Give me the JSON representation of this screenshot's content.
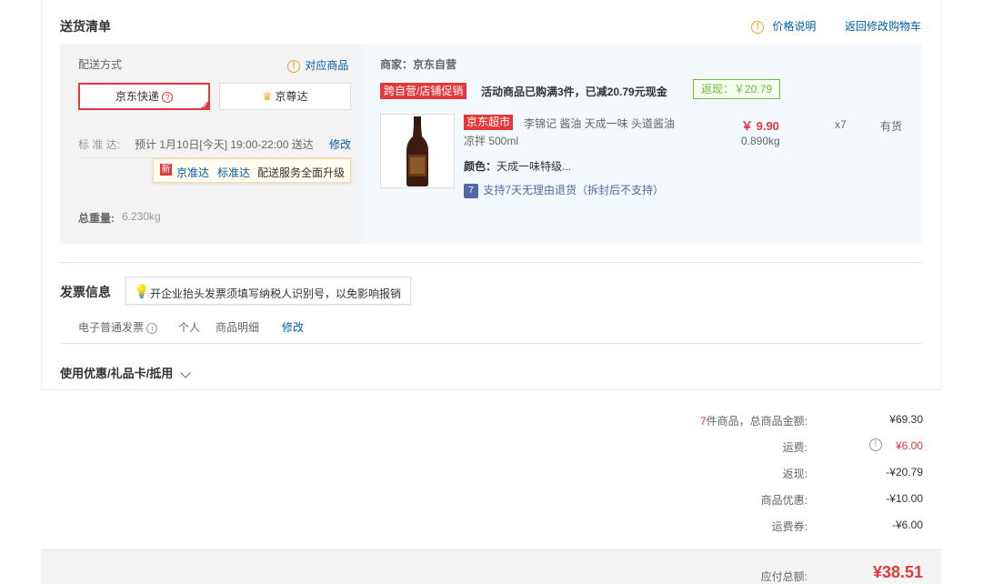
{
  "header": {
    "title": "送货清单",
    "price_note": "价格说明",
    "back_cart": "返回修改购物车"
  },
  "shipping": {
    "method_label": "配送方式",
    "related_goods": "对应商品",
    "option_selected": "京东快递",
    "option_other": "京尊达",
    "schedule_label": "标 准 达:",
    "schedule_value": "预计 1月10日[今天] 19:00-22:00 送达",
    "modify": "修改",
    "tip_badge": "新",
    "tip_link1": "京准达",
    "tip_link2": "标准达",
    "tip_text": "配送服务全面升级",
    "weight_label": "总重量:",
    "weight_value": "6.230kg"
  },
  "merchant": {
    "label": "商家：京东自营",
    "promo_tag": "跨自营/店铺促销",
    "promo_text": "活动商品已购满3件，已减20.79元现金",
    "rebate": "返现：￥20.79"
  },
  "product": {
    "store_tag": "京东超市",
    "name": "李锦记 酱油 天成一味 头道酱油 凉拌 500ml",
    "price": "￥ 9.90",
    "weight": "0.890kg",
    "qty": "x7",
    "stock": "有货",
    "color_label": "颜色：",
    "color_value": "天成一味特级...",
    "return_badge": "7",
    "return_text": "支持7天无理由退货（拆封后不支持）"
  },
  "invoice": {
    "title": "发票信息",
    "tip": "开企业抬头发票须填写纳税人识别号，以免影响报销",
    "type": "电子普通发票",
    "personal": "个人",
    "detail": "商品明细",
    "modify": "修改"
  },
  "discount": {
    "title": "使用优惠/礼品卡/抵用"
  },
  "summary": {
    "count": "7",
    "count_suffix": "件商品，总商品金额:",
    "total_goods": "¥69.30",
    "freight_label": "运费:",
    "freight": "¥6.00",
    "rebate_label": "返现:",
    "rebate": "-¥20.79",
    "goods_discount_label": "商品优惠:",
    "goods_discount": "-¥10.00",
    "freight_coupon_label": "运费券:",
    "freight_coupon": "-¥6.00",
    "payable_label": "应付总额:",
    "payable": "¥38.51"
  },
  "colors": {
    "accent_red": "#e4393c",
    "link_blue": "#005ea7",
    "rebate_green": "#6dbb3a",
    "orange": "#f5a623"
  }
}
